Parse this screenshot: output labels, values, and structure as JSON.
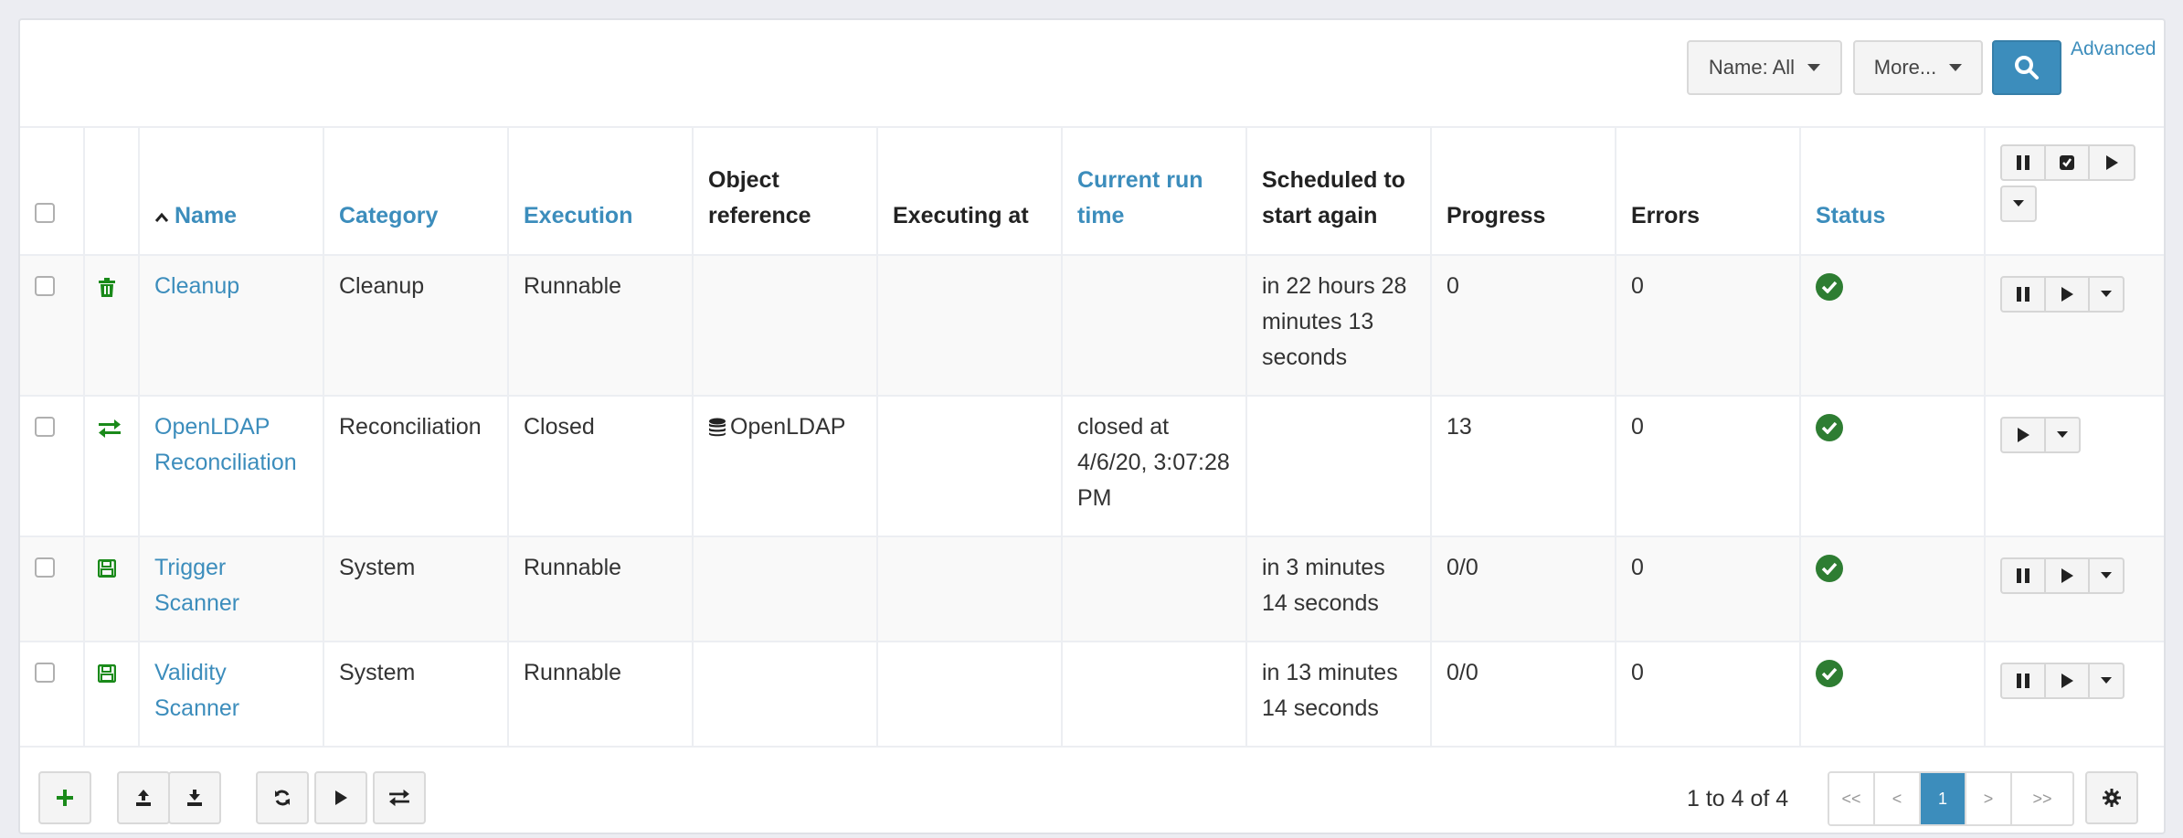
{
  "toolbar": {
    "name_filter_label": "Name: All",
    "more_label": "More...",
    "advanced_label": "Advanced"
  },
  "table": {
    "headers": {
      "name": "Name",
      "category": "Category",
      "execution": "Execution",
      "object_reference": "Object reference",
      "executing_at": "Executing at",
      "current_run_time": "Current run time",
      "scheduled": "Scheduled to start again",
      "progress": "Progress",
      "errors": "Errors",
      "status": "Status"
    },
    "rows": [
      {
        "icon": "trash-icon",
        "name": "Cleanup",
        "category": "Cleanup",
        "execution": "Runnable",
        "object_reference": "",
        "executing_at": "",
        "current_run_time": "",
        "scheduled": "in 22 hours 28 minutes 13 seconds",
        "progress": "0",
        "errors": "0",
        "status": "ok"
      },
      {
        "icon": "exchange-icon",
        "name": "OpenLDAP Reconciliation",
        "category": "Reconciliation",
        "execution": "Closed",
        "object_reference": "OpenLDAP",
        "executing_at": "",
        "current_run_time": "closed at 4/6/20, 3:07:28 PM",
        "scheduled": "",
        "progress": "13",
        "errors": "0",
        "status": "ok"
      },
      {
        "icon": "save-icon",
        "name": "Trigger Scanner",
        "category": "System",
        "execution": "Runnable",
        "object_reference": "",
        "executing_at": "",
        "current_run_time": "",
        "scheduled": "in 3 minutes 14 seconds",
        "progress": "0/0",
        "errors": "0",
        "status": "ok"
      },
      {
        "icon": "save-icon",
        "name": "Validity Scanner",
        "category": "System",
        "execution": "Runnable",
        "object_reference": "",
        "executing_at": "",
        "current_run_time": "",
        "scheduled": "in 13 minutes 14 seconds",
        "progress": "0/0",
        "errors": "0",
        "status": "ok"
      }
    ]
  },
  "pagination": {
    "summary": "1 to 4 of 4",
    "first": "<<",
    "prev": "<",
    "current": "1",
    "next": ">",
    "last": ">>"
  },
  "colors": {
    "accent": "#3c8dbc",
    "status_ok": "#2e7d32",
    "icon_green": "#1a8a1a"
  }
}
